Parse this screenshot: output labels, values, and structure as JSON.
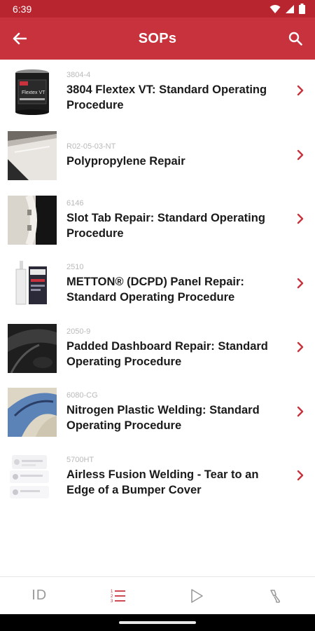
{
  "status_bar": {
    "time": "6:39"
  },
  "app_bar": {
    "title": "SOPs"
  },
  "items": [
    {
      "code": "3804-4",
      "title": "3804 Flextex VT: Standard Operating Procedure",
      "thumb_label": "Flextex VT",
      "thumb_icon": "can-product-image"
    },
    {
      "code": "R02-05-03-NT",
      "title": "Polypropylene Repair",
      "thumb_icon": "panel-repair-image"
    },
    {
      "code": "6146",
      "title": "Slot Tab Repair:  Standard Operating Procedure",
      "thumb_icon": "slot-tab-image"
    },
    {
      "code": "2510",
      "title": "METTON® (DCPD) Panel Repair: Standard Operating Procedure",
      "thumb_icon": "adhesive-cartridge-image"
    },
    {
      "code": "2050-9",
      "title": "Padded Dashboard Repair: Standard Operating Procedure",
      "thumb_icon": "dashboard-image"
    },
    {
      "code": "6080-CG",
      "title": "Nitrogen Plastic Welding: Standard Operating Procedure",
      "thumb_icon": "plastic-welding-image"
    },
    {
      "code": "5700HT",
      "title": "Airless Fusion Welding - Tear to an Edge of a Bumper Cover",
      "thumb_icon": "document-list-image"
    }
  ],
  "bottom_nav": {
    "id_label": "ID",
    "tabs": [
      "id-tab",
      "list-tab",
      "play-tab",
      "tool-tab"
    ],
    "active": "list-tab"
  },
  "colors": {
    "primary": "#c8323c",
    "status": "#b8252f",
    "chevron": "#c8323c",
    "muted": "#9a9a9a"
  }
}
